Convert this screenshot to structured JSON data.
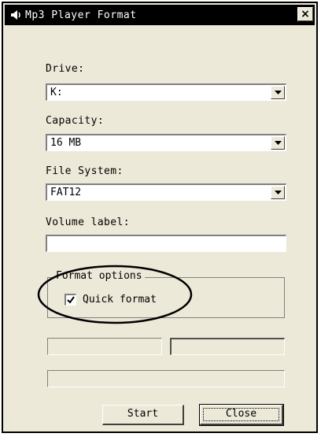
{
  "window": {
    "title": "Mp3 Player Format",
    "close_label": "×"
  },
  "drive": {
    "label": "Drive:",
    "value": "K:"
  },
  "capacity": {
    "label": "Capacity:",
    "value": "16 MB"
  },
  "file_system": {
    "label": "File System:",
    "value": "FAT12"
  },
  "volume_label": {
    "label": "Volume label:",
    "value": ""
  },
  "format_options": {
    "legend": "Format options",
    "quick_format_label": "Quick format",
    "quick_format_checked": true
  },
  "buttons": {
    "start": "Start",
    "close": "Close"
  }
}
